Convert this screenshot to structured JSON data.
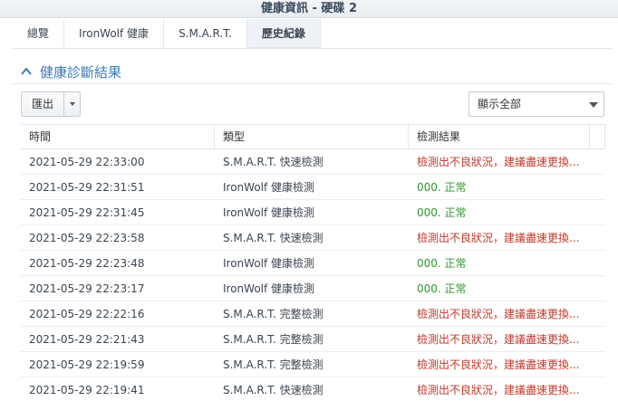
{
  "window": {
    "title": "健康資訊 - 硬碟 2"
  },
  "tabs": [
    {
      "label": "總覽",
      "active": false
    },
    {
      "label": "IronWolf 健康",
      "active": false
    },
    {
      "label": "S.M.A.R.T.",
      "active": false
    },
    {
      "label": "歷史紀錄",
      "active": true
    }
  ],
  "section": {
    "title": "健康診斷結果",
    "icon": "chevron-up-icon"
  },
  "toolbar": {
    "export_label": "匯出",
    "export_menu_icon": "caret-down-icon",
    "filter_value": "顯示全部",
    "filter_icon": "caret-down-icon"
  },
  "table": {
    "columns": [
      "時間",
      "類型",
      "檢測結果"
    ],
    "rows": [
      {
        "time": "2021-05-29 22:33:00",
        "type": "S.M.A.R.T. 快速檢測",
        "result": "檢測出不良狀況，建議盡速更換...",
        "status": "bad"
      },
      {
        "time": "2021-05-29 22:31:51",
        "type": "IronWolf 健康檢測",
        "result": "000. 正常",
        "status": "good"
      },
      {
        "time": "2021-05-29 22:31:45",
        "type": "IronWolf 健康檢測",
        "result": "000. 正常",
        "status": "good"
      },
      {
        "time": "2021-05-29 22:23:58",
        "type": "S.M.A.R.T. 快速檢測",
        "result": "檢測出不良狀況，建議盡速更換...",
        "status": "bad"
      },
      {
        "time": "2021-05-29 22:23:48",
        "type": "IronWolf 健康檢測",
        "result": "000. 正常",
        "status": "good"
      },
      {
        "time": "2021-05-29 22:23:17",
        "type": "IronWolf 健康檢測",
        "result": "000. 正常",
        "status": "good"
      },
      {
        "time": "2021-05-29 22:22:16",
        "type": "S.M.A.R.T. 完整檢測",
        "result": "檢測出不良狀況，建議盡速更換...",
        "status": "bad"
      },
      {
        "time": "2021-05-29 22:21:43",
        "type": "S.M.A.R.T. 完整檢測",
        "result": "檢測出不良狀況，建議盡速更換...",
        "status": "bad"
      },
      {
        "time": "2021-05-29 22:19:59",
        "type": "S.M.A.R.T. 完整檢測",
        "result": "檢測出不良狀況，建議盡速更換...",
        "status": "bad"
      },
      {
        "time": "2021-05-29 22:19:41",
        "type": "S.M.A.R.T. 快速檢測",
        "result": "檢測出不良狀況，建議盡速更換...",
        "status": "bad"
      }
    ]
  },
  "colors": {
    "accent": "#3d7ab8",
    "bad": "#c0392b",
    "good": "#2e9a2e"
  }
}
